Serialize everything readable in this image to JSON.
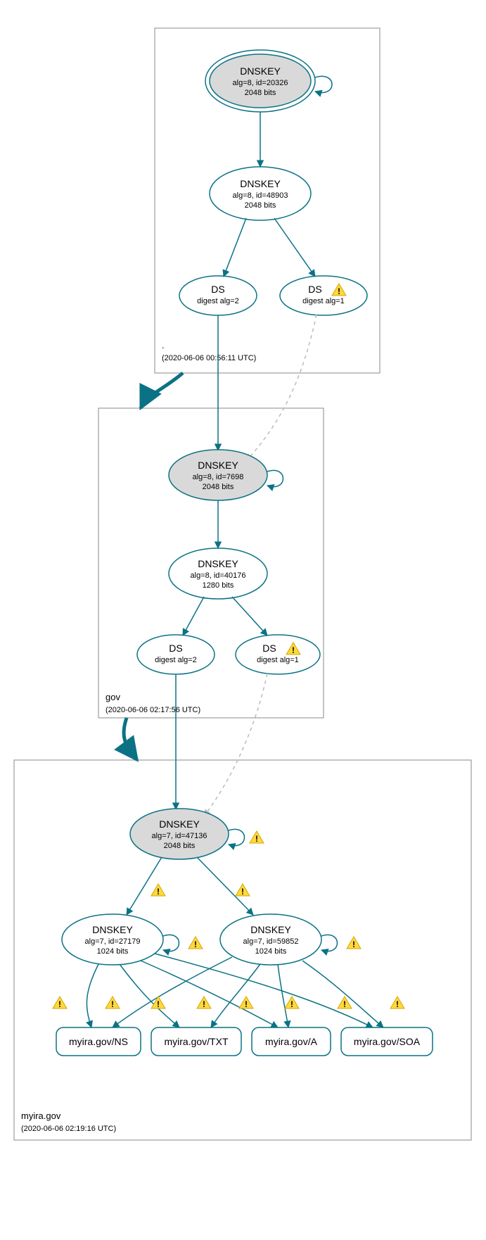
{
  "zones": {
    "root": {
      "label": ".",
      "sublabel": "(2020-06-06 00:56:11 UTC)"
    },
    "gov": {
      "label": "gov",
      "sublabel": "(2020-06-06 02:17:56 UTC)"
    },
    "myira": {
      "label": "myira.gov",
      "sublabel": "(2020-06-06 02:19:16 UTC)"
    }
  },
  "nodes": {
    "root_ksk": {
      "title": "DNSKEY",
      "line2": "alg=8, id=20326",
      "line3": "2048 bits"
    },
    "root_zsk": {
      "title": "DNSKEY",
      "line2": "alg=8, id=48903",
      "line3": "2048 bits"
    },
    "root_ds2": {
      "title": "DS",
      "line2": "digest alg=2"
    },
    "root_ds1": {
      "title": "DS",
      "line2": "digest alg=1"
    },
    "gov_ksk": {
      "title": "DNSKEY",
      "line2": "alg=8, id=7698",
      "line3": "2048 bits"
    },
    "gov_zsk": {
      "title": "DNSKEY",
      "line2": "alg=8, id=40176",
      "line3": "1280 bits"
    },
    "gov_ds2": {
      "title": "DS",
      "line2": "digest alg=2"
    },
    "gov_ds1": {
      "title": "DS",
      "line2": "digest alg=1"
    },
    "my_ksk": {
      "title": "DNSKEY",
      "line2": "alg=7, id=47136",
      "line3": "2048 bits"
    },
    "my_zsk1": {
      "title": "DNSKEY",
      "line2": "alg=7, id=27179",
      "line3": "1024 bits"
    },
    "my_zsk2": {
      "title": "DNSKEY",
      "line2": "alg=7, id=59852",
      "line3": "1024 bits"
    },
    "rr_ns": {
      "title": "myira.gov/NS"
    },
    "rr_txt": {
      "title": "myira.gov/TXT"
    },
    "rr_a": {
      "title": "myira.gov/A"
    },
    "rr_soa": {
      "title": "myira.gov/SOA"
    }
  },
  "warn_label": "!"
}
